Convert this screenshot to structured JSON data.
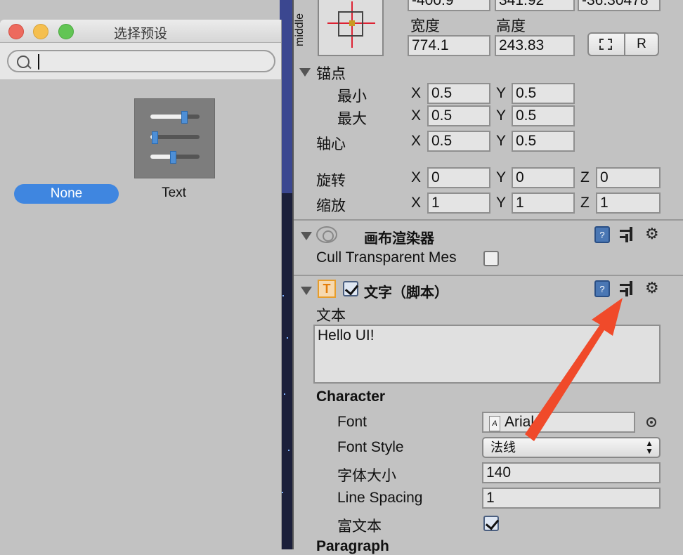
{
  "preset_window": {
    "title": "选择预设",
    "search": {
      "value": "",
      "placeholder": ""
    },
    "presets": [
      {
        "label": "None",
        "selected": true
      },
      {
        "label": "Text",
        "selected": false,
        "icon": "sliders-preset-icon"
      }
    ]
  },
  "inspector": {
    "rect_transform": {
      "anchor_preset_label": "middle",
      "pos_top_values": [
        "-400.9",
        "341.92",
        "-36.30478"
      ],
      "width_label": "宽度",
      "height_label": "高度",
      "width_value": "774.1",
      "height_value": "243.83",
      "raw_button_label": "R",
      "anchors_label": "锚点",
      "min_label": "最小",
      "max_label": "最大",
      "pivot_label": "轴心",
      "rotation_label": "旋转",
      "scale_label": "缩放",
      "axis_x": "X",
      "axis_y": "Y",
      "axis_z": "Z",
      "min_x": "0.5",
      "min_y": "0.5",
      "max_x": "0.5",
      "max_y": "0.5",
      "pivot_x": "0.5",
      "pivot_y": "0.5",
      "rot_x": "0",
      "rot_y": "0",
      "rot_z": "0",
      "scale_x": "1",
      "scale_y": "1",
      "scale_z": "1"
    },
    "canvas_renderer": {
      "title": "画布渲染器",
      "cull_label": "Cull Transparent Mes",
      "cull_checked": false
    },
    "text_component": {
      "title": "文字（脚本）",
      "enabled": true,
      "text_label": "文本",
      "text_value": "Hello UI!",
      "character_header": "Character",
      "font_label": "Font",
      "font_value": "Arial",
      "font_style_label": "Font Style",
      "font_style_value": "法线",
      "font_size_label": "字体大小",
      "font_size_value": "140",
      "line_spacing_label": "Line Spacing",
      "line_spacing_value": "1",
      "rich_text_label": "富文本",
      "rich_text_checked": true,
      "paragraph_header": "Paragraph"
    },
    "annotation": {
      "arrow_color": "#f04a2a",
      "points_to": "preset-icon"
    }
  }
}
